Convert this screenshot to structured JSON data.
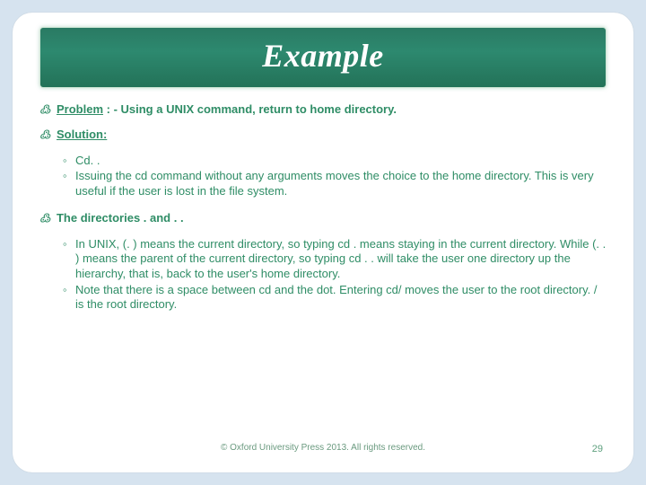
{
  "title": "Example",
  "problem": {
    "label": "Problem",
    "text": " : - Using a UNIX command, return to home directory."
  },
  "solution": {
    "label": "Solution:",
    "items": [
      "Cd. .",
      "Issuing the cd command without any arguments moves the choice to the home directory. This is very useful if the user is lost in the file system."
    ]
  },
  "dirs": {
    "heading": "The directories . and . .",
    "items": [
      "In UNIX, (. ) means the current directory, so typing cd . means staying in the current directory. While (. . ) means the parent of the current directory, so typing  cd . . will take the user one directory up the hierarchy, that is, back to the user's home directory.",
      "Note that there is a space between cd and the dot. Entering cd/ moves the user to the root directory. / is the root directory."
    ]
  },
  "footer": "© Oxford University Press 2013. All rights reserved.",
  "page": "29",
  "glyphs": {
    "arrow": "߷",
    "ring": "◦"
  }
}
